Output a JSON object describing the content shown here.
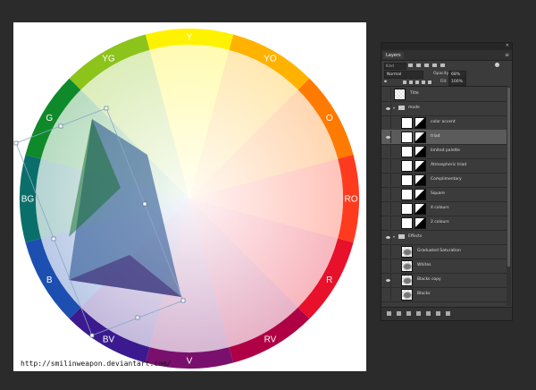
{
  "wheel": {
    "segments": [
      {
        "label": "Y",
        "color": "#fff200"
      },
      {
        "label": "YO",
        "color": "#ffb300"
      },
      {
        "label": "O",
        "color": "#ff7a00"
      },
      {
        "label": "RO",
        "color": "#ff3b1f"
      },
      {
        "label": "R",
        "color": "#e8102a"
      },
      {
        "label": "RV",
        "color": "#b00045"
      },
      {
        "label": "V",
        "color": "#7a106e"
      },
      {
        "label": "BV",
        "color": "#3b1a8f"
      },
      {
        "label": "B",
        "color": "#1c4fb0"
      },
      {
        "label": "BG",
        "color": "#0a6f6a"
      },
      {
        "label": "G",
        "color": "#0f8a2a"
      },
      {
        "label": "YG",
        "color": "#8cc41c"
      }
    ],
    "credit": "http://smilinweapon.deviantart.com/"
  },
  "layers_panel": {
    "tab": "Layers",
    "kind_filter": "Kind",
    "blend_mode": "Normal",
    "opacity_label": "Opacity:",
    "opacity_value": "68%",
    "fill_label": "Fill:",
    "fill_value": "100%",
    "layers": [
      {
        "name": "Title",
        "type": "layer",
        "visible": false,
        "selected": false
      },
      {
        "name": "mode",
        "type": "group",
        "visible": true,
        "selected": false
      },
      {
        "name": "color accent",
        "type": "layer",
        "visible": false,
        "selected": false
      },
      {
        "name": "triad",
        "type": "layer",
        "visible": true,
        "selected": true
      },
      {
        "name": "limited palette",
        "type": "layer",
        "visible": false,
        "selected": false
      },
      {
        "name": "Atmospheric triad",
        "type": "layer",
        "visible": false,
        "selected": false
      },
      {
        "name": "Complimentary",
        "type": "layer",
        "visible": false,
        "selected": false
      },
      {
        "name": "Square",
        "type": "layer",
        "visible": false,
        "selected": false
      },
      {
        "name": "4 colours",
        "type": "layer",
        "visible": false,
        "selected": false
      },
      {
        "name": "2 colours",
        "type": "layer",
        "visible": false,
        "selected": false
      },
      {
        "name": "Effects",
        "type": "group",
        "visible": true,
        "selected": false
      },
      {
        "name": "Graduated Saturation",
        "type": "fx",
        "visible": false,
        "selected": false
      },
      {
        "name": "Whites",
        "type": "fx",
        "visible": false,
        "selected": false
      },
      {
        "name": "Blacks copy",
        "type": "fx",
        "visible": true,
        "selected": false
      },
      {
        "name": "Blacks",
        "type": "fx",
        "visible": false,
        "selected": false
      }
    ]
  }
}
